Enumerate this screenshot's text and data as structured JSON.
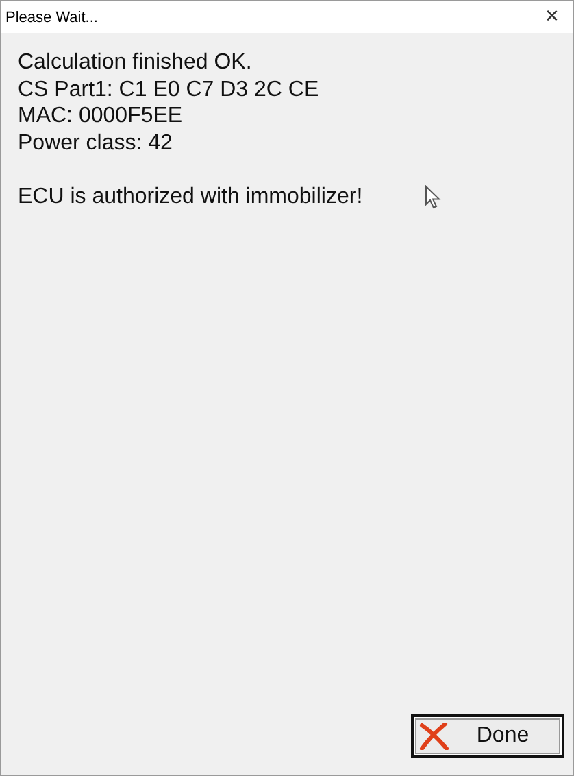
{
  "window": {
    "title": "Please Wait...",
    "close_glyph": "✕"
  },
  "message": {
    "lines": [
      "Calculation finished OK.",
      "CS Part1: C1 E0 C7 D3 2C CE",
      "MAC: 0000F5EE",
      "Power class: 42"
    ],
    "result": "ECU is authorized with immobilizer!"
  },
  "buttons": [
    {
      "label": "Done",
      "kind": "default"
    }
  ]
}
